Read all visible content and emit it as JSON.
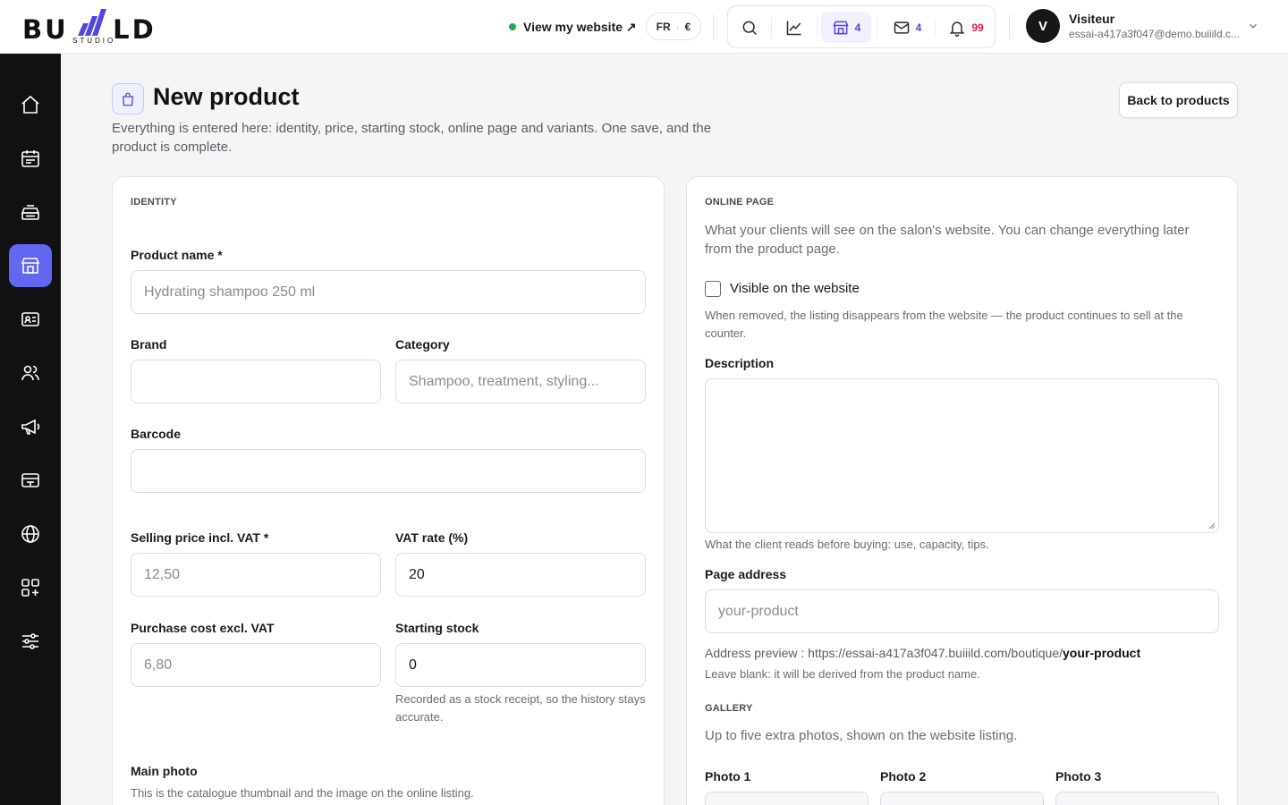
{
  "brand": {
    "word": "BUILD",
    "sub": "STUDIO",
    "accent": "#4f46e5"
  },
  "topbar": {
    "view_site": "View my website ↗",
    "locale_lang": "FR",
    "locale_sep": "·",
    "locale_currency": "€",
    "icons": [
      {
        "name": "search-icon",
        "count": ""
      },
      {
        "name": "chart-icon",
        "count": ""
      },
      {
        "name": "store-icon",
        "count": "4"
      },
      {
        "name": "mail-icon",
        "count": "4"
      },
      {
        "name": "bell-icon",
        "count": "99"
      }
    ],
    "user": {
      "initial": "V",
      "name": "Visiteur",
      "email": "essai-a417a3f047@demo.buiiild.c..."
    }
  },
  "sidebar": {
    "items": [
      {
        "name": "home-icon",
        "active": false
      },
      {
        "name": "calendar-icon",
        "active": false
      },
      {
        "name": "cash-register-icon",
        "active": false
      },
      {
        "name": "store-icon",
        "active": true
      },
      {
        "name": "id-card-icon",
        "active": false
      },
      {
        "name": "users-icon",
        "active": false
      },
      {
        "name": "megaphone-icon",
        "active": false
      },
      {
        "name": "payment-terminal-icon",
        "active": false
      },
      {
        "name": "globe-icon",
        "active": false
      },
      {
        "name": "apps-add-icon",
        "active": false
      },
      {
        "name": "sliders-icon",
        "active": false
      }
    ]
  },
  "header": {
    "title": "New product",
    "description": "Everything is entered here: identity, price, starting stock, online page and variants. One save, and the product is complete.",
    "back_button": "Back to products"
  },
  "identity": {
    "section": "IDENTITY",
    "product_name_label": "Product name *",
    "product_name_placeholder": "Hydrating shampoo 250 ml",
    "brand_label": "Brand",
    "brand_value": "",
    "category_label": "Category",
    "category_placeholder": "Shampoo, treatment, styling...",
    "barcode_label": "Barcode",
    "barcode_value": "",
    "price_label": "Selling price incl. VAT *",
    "price_placeholder": "12,50",
    "vat_label": "VAT rate (%)",
    "vat_value": "20",
    "cost_label": "Purchase cost excl. VAT",
    "cost_placeholder": "6,80",
    "stock_label": "Starting stock",
    "stock_value": "0",
    "stock_hint": "Recorded as a stock receipt, so the history stays accurate.",
    "photo_label": "Main photo",
    "photo_hint": "This is the catalogue thumbnail and the image on the online listing."
  },
  "online": {
    "section": "ONLINE PAGE",
    "intro": "What your clients will see on the salon's website. You can change everything later from the product page.",
    "visible_label": "Visible on the website",
    "visible_checked": false,
    "visible_hint": "When removed, the listing disappears from the website — the product continues to sell at the counter.",
    "description_label": "Description",
    "description_value": "",
    "description_hint": "What the client reads before buying: use, capacity, tips.",
    "address_label": "Page address",
    "address_placeholder": "your-product",
    "preview_prefix": "Address preview : https://essai-a417a3f047.buiiild.com/boutique/",
    "preview_slug": "your-product",
    "address_hint": "Leave blank: it will be derived from the product name.",
    "gallery_section": "GALLERY",
    "gallery_intro": "Up to five extra photos, shown on the website listing.",
    "photos": [
      "Photo 1",
      "Photo 2",
      "Photo 3"
    ]
  }
}
